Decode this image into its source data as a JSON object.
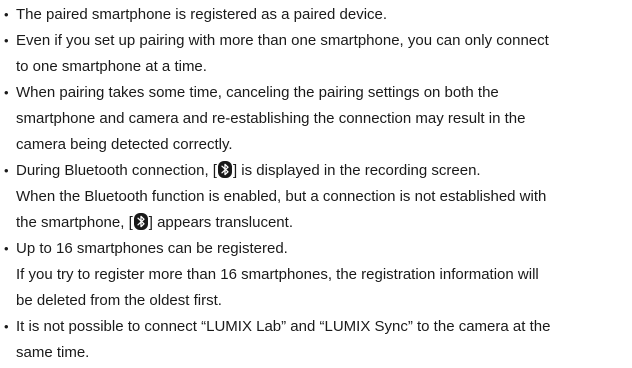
{
  "bullet_char": "•",
  "items": [
    {
      "lines": [
        "The paired smartphone is registered as a paired device."
      ]
    },
    {
      "lines": [
        "Even if you set up pairing with more than one smartphone, you can only connect",
        "to one smartphone at a time."
      ]
    },
    {
      "lines": [
        "When pairing takes some time, canceling the pairing settings on both the",
        "smartphone and camera and re-establishing the connection may result in the",
        "camera being detected correctly."
      ]
    },
    {
      "line1_before": "During Bluetooth connection, [",
      "line1_after": "] is displayed in the recording screen.",
      "line2": "When the Bluetooth function is enabled, but a connection is not established with",
      "line3_before": "the smartphone, [",
      "line3_after": "] appears translucent.",
      "icon": "bluetooth-icon"
    },
    {
      "lines": [
        "Up to 16 smartphones can be registered.",
        "If you try to register more than 16 smartphones, the registration information will",
        "be deleted from the oldest first."
      ]
    },
    {
      "lines": [
        "It is not possible to connect “LUMIX Lab” and “LUMIX Sync” to the camera at the",
        "same time."
      ]
    }
  ]
}
